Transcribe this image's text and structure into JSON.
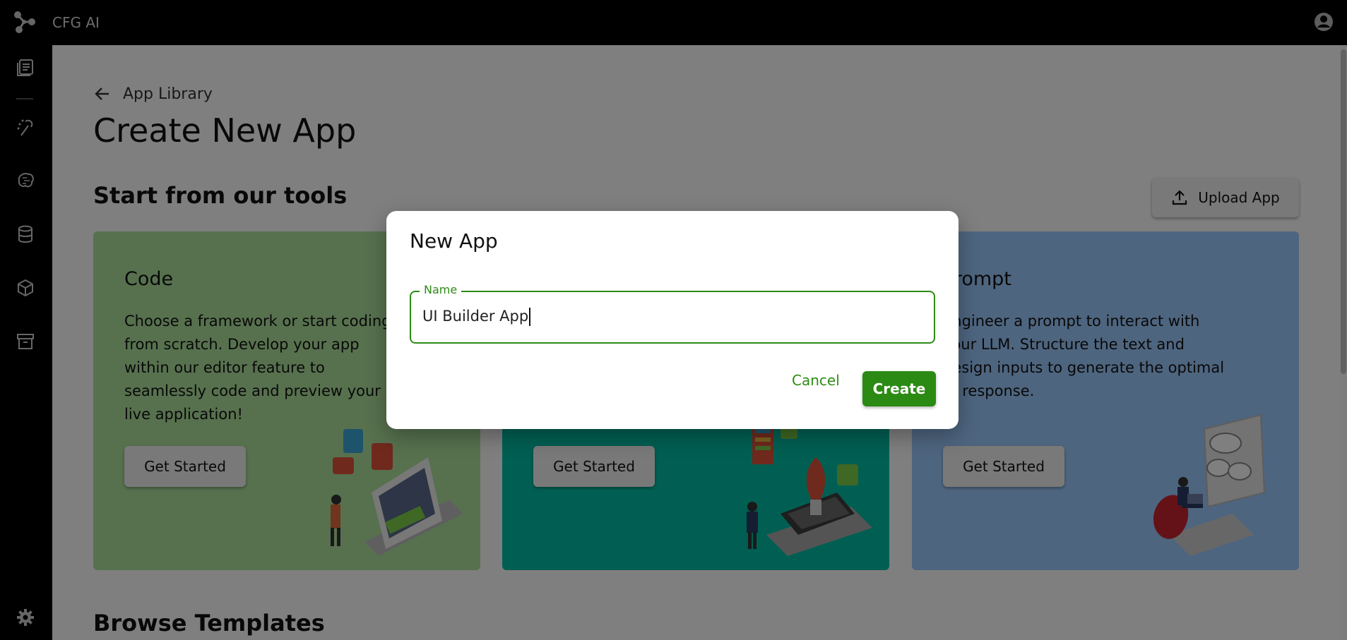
{
  "app": {
    "title": "CFG AI"
  },
  "sidebar": {
    "items": [
      {
        "icon": "library-icon"
      },
      {
        "icon": "magic-wand-icon"
      },
      {
        "icon": "brain-icon"
      },
      {
        "icon": "database-icon"
      },
      {
        "icon": "cube-icon"
      },
      {
        "icon": "archive-icon"
      },
      {
        "icon": "gear-icon"
      }
    ]
  },
  "breadcrumb": {
    "label": "App Library"
  },
  "page": {
    "title": "Create New App",
    "section_title": "Start from our tools",
    "upload_label": "Upload App",
    "templates_title": "Browse Templates"
  },
  "cards": [
    {
      "title": "Code",
      "desc": "Choose a framework or start coding from scratch. Develop your app within our editor feature to seamlessly code and preview your live application!",
      "button": "Get Started",
      "color": "#aee29d"
    },
    {
      "title": "",
      "desc": "",
      "button": "Get Started",
      "color": "#00bfa5"
    },
    {
      "title": "Prompt",
      "desc": "Engineer a prompt to interact with your LLM. Structure the text and design inputs to generate the optimal AI response.",
      "button": "Get Started",
      "color": "#9dcbff"
    }
  ],
  "dialog": {
    "title": "New App",
    "field_label": "Name",
    "field_value": "UI Builder App",
    "cancel_label": "Cancel",
    "create_label": "Create"
  },
  "colors": {
    "accent_green": "#2b8a13",
    "topbar": "#000000"
  }
}
